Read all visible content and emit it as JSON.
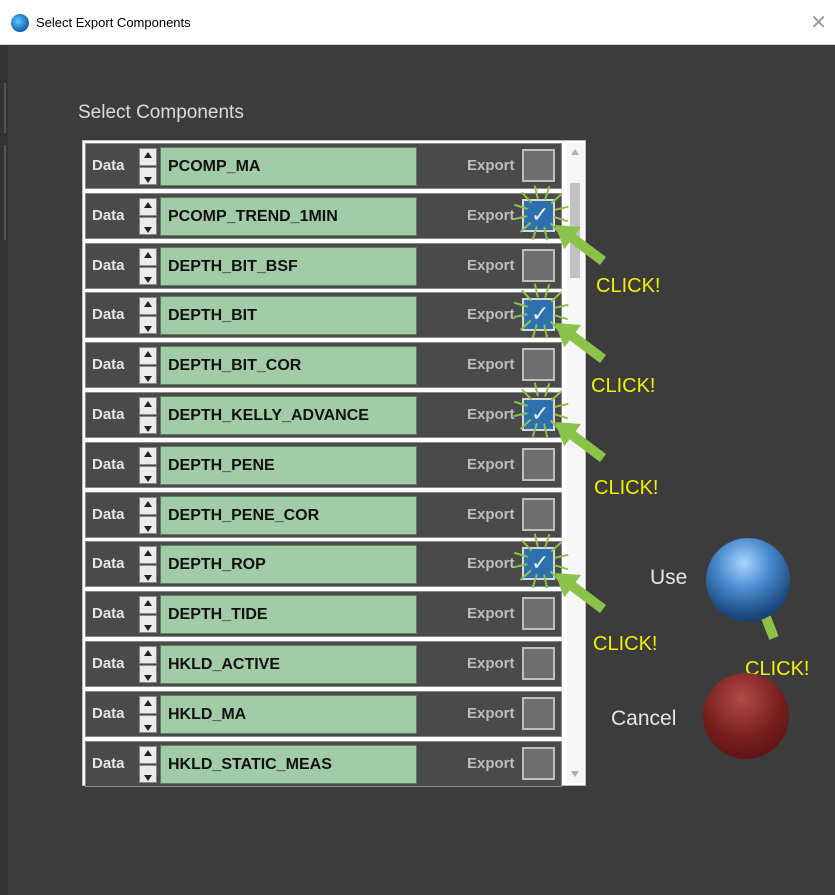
{
  "window": {
    "title": "Select Export Components",
    "close_glyph": "✕"
  },
  "heading": "Select Components",
  "rows": [
    {
      "data_label": "Data",
      "name": "PCOMP_MA",
      "export_label": "Export",
      "checked": false
    },
    {
      "data_label": "Data",
      "name": "PCOMP_TREND_1MIN",
      "export_label": "Export",
      "checked": true
    },
    {
      "data_label": "Data",
      "name": "DEPTH_BIT_BSF",
      "export_label": "Export",
      "checked": false
    },
    {
      "data_label": "Data",
      "name": "DEPTH_BIT",
      "export_label": "Export",
      "checked": true
    },
    {
      "data_label": "Data",
      "name": "DEPTH_BIT_COR",
      "export_label": "Export",
      "checked": false
    },
    {
      "data_label": "Data",
      "name": "DEPTH_KELLY_ADVANCE",
      "export_label": "Export",
      "checked": true
    },
    {
      "data_label": "Data",
      "name": "DEPTH_PENE",
      "export_label": "Export",
      "checked": false
    },
    {
      "data_label": "Data",
      "name": "DEPTH_PENE_COR",
      "export_label": "Export",
      "checked": false
    },
    {
      "data_label": "Data",
      "name": "DEPTH_ROP",
      "export_label": "Export",
      "checked": true
    },
    {
      "data_label": "Data",
      "name": "DEPTH_TIDE",
      "export_label": "Export",
      "checked": false
    },
    {
      "data_label": "Data",
      "name": "HKLD_ACTIVE",
      "export_label": "Export",
      "checked": false
    },
    {
      "data_label": "Data",
      "name": "HKLD_MA",
      "export_label": "Export",
      "checked": false
    },
    {
      "data_label": "Data",
      "name": "HKLD_STATIC_MEAS",
      "export_label": "Export",
      "checked": false
    }
  ],
  "actions": {
    "use_label": "Use",
    "cancel_label": "Cancel"
  },
  "annotations": {
    "click_text": "CLICK!"
  },
  "colors": {
    "name_field": "#a2cba8",
    "checkbox_checked": "#2e6fad",
    "annotation_arrow": "#8bc34a",
    "annotation_text": "#f3f000",
    "use_button": "#2a6bb0",
    "cancel_button": "#7a1f1f"
  }
}
